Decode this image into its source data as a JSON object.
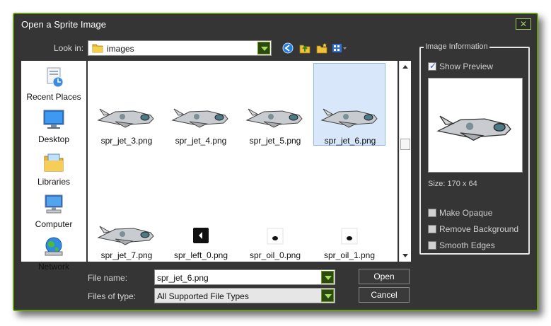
{
  "window": {
    "title": "Open a Sprite Image",
    "close_glyph": "✕"
  },
  "lookin": {
    "label": "Look in:",
    "value": "images",
    "toolbar_icons": [
      "back-icon",
      "up-folder-icon",
      "new-folder-icon",
      "view-menu-icon"
    ]
  },
  "places": [
    {
      "label": "Recent Places",
      "icon": "recent-places-icon"
    },
    {
      "label": "Desktop",
      "icon": "desktop-icon"
    },
    {
      "label": "Libraries",
      "icon": "libraries-icon"
    },
    {
      "label": "Computer",
      "icon": "computer-icon"
    },
    {
      "label": "Network",
      "icon": "network-icon"
    }
  ],
  "files": [
    {
      "name": "spr_jet_3.png",
      "thumb": "jet",
      "selected": false
    },
    {
      "name": "spr_jet_4.png",
      "thumb": "jet",
      "selected": false
    },
    {
      "name": "spr_jet_5.png",
      "thumb": "jet",
      "selected": false
    },
    {
      "name": "spr_jet_6.png",
      "thumb": "jet",
      "selected": true
    },
    {
      "name": "spr_jet_7.png",
      "thumb": "jet",
      "selected": false
    },
    {
      "name": "spr_left_0.png",
      "thumb": "arrow",
      "selected": false
    },
    {
      "name": "spr_oil_0.png",
      "thumb": "oil",
      "selected": false
    },
    {
      "name": "spr_oil_1.png",
      "thumb": "oil",
      "selected": false
    }
  ],
  "filename": {
    "label": "File name:",
    "value": "spr_jet_6.png"
  },
  "filetype": {
    "label": "Files of type:",
    "value": "All Supported File Types"
  },
  "buttons": {
    "open": "Open",
    "cancel": "Cancel"
  },
  "info": {
    "legend": "Image Information",
    "show_preview": {
      "label": "Show Preview",
      "checked": true
    },
    "size": "Size: 170 x 64",
    "options": [
      {
        "label": "Make Opaque",
        "checked": false
      },
      {
        "label": "Remove Background",
        "checked": false
      },
      {
        "label": "Smooth Edges",
        "checked": false
      }
    ]
  },
  "colors": {
    "dialog_bg": "#353535",
    "accent_green": "#6a9a1c",
    "selection": "#d8e8fa"
  }
}
